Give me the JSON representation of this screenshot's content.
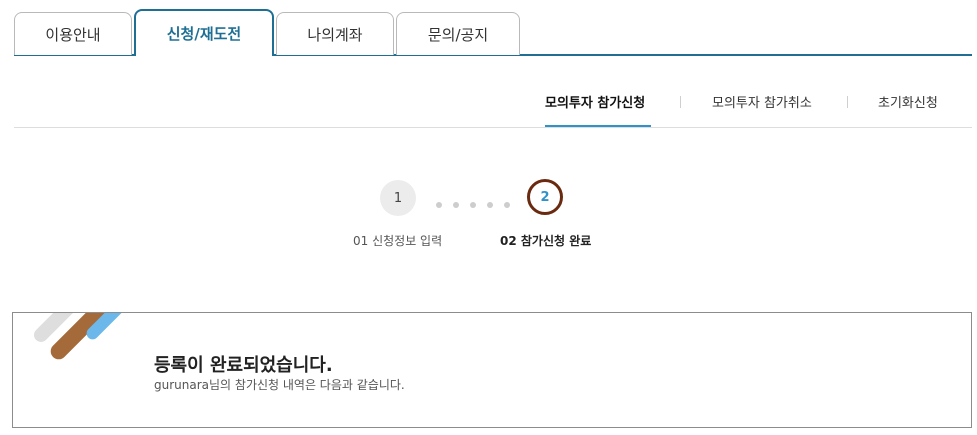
{
  "main_tabs": {
    "items": [
      {
        "label": "이용안내"
      },
      {
        "label": "신청/재도전"
      },
      {
        "label": "나의계좌"
      },
      {
        "label": "문의/공지"
      }
    ],
    "active_index": 1
  },
  "sub_nav": {
    "items": [
      {
        "label": "모의투자 참가신청"
      },
      {
        "label": "모의투자 참가취소"
      },
      {
        "label": "초기화신청"
      }
    ],
    "active_index": 0
  },
  "steps": {
    "items": [
      {
        "number": "1",
        "label": "01 신청정보 입력"
      },
      {
        "number": "2",
        "label": "02 참가신청 완료"
      }
    ],
    "current": 2
  },
  "result": {
    "title": "등록이 완료되었습니다.",
    "description": "gurunara님의 참가신청 내역은 다음과 같습니다."
  },
  "colors": {
    "primary": "#1f6f94",
    "accent_blue": "#2f93c9",
    "step_ring": "#6a2a10",
    "stripe_brown": "#a56a39",
    "stripe_blue": "#6cb8ea",
    "stripe_gray": "#dedede"
  }
}
